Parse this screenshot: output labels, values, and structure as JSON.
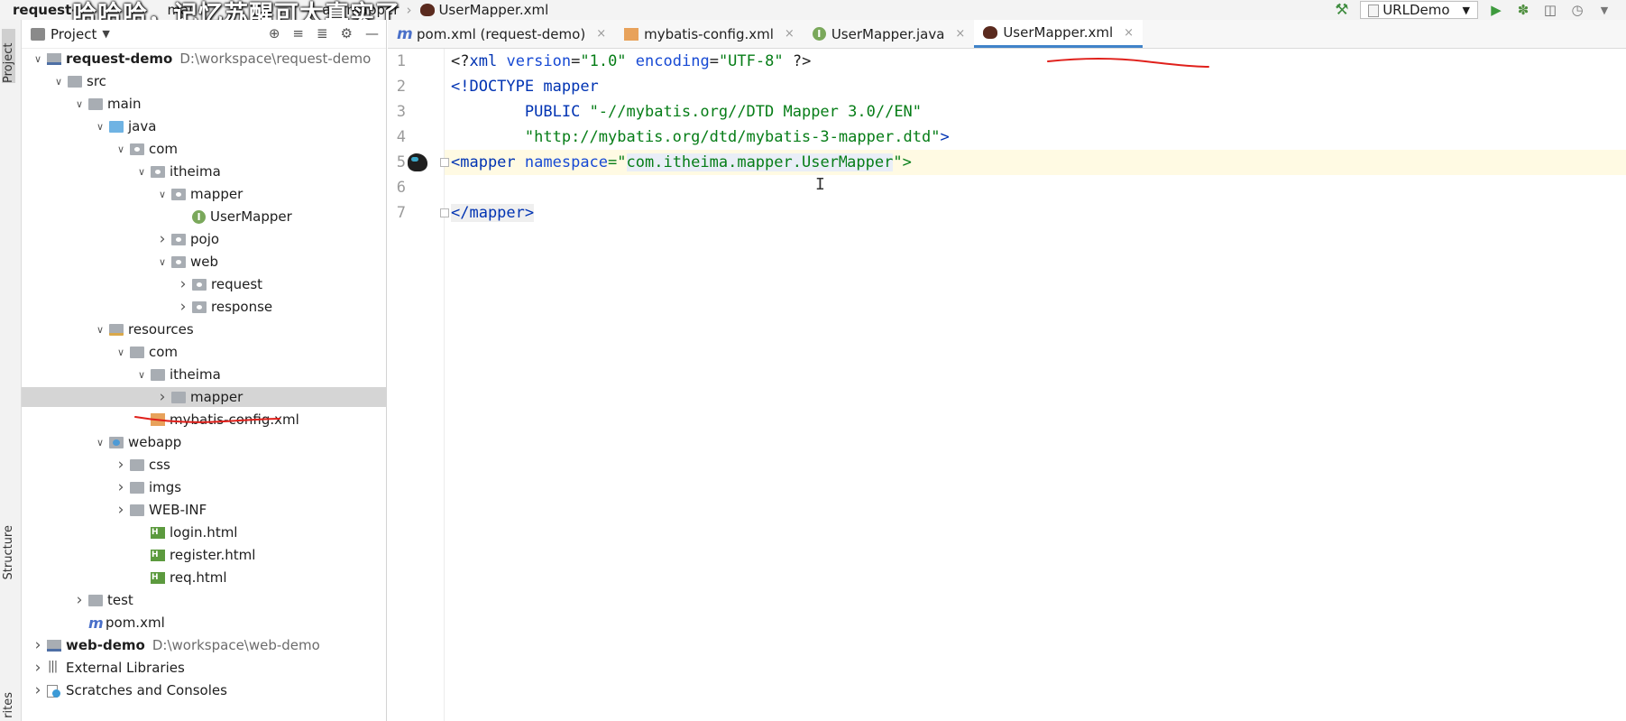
{
  "navbar": {
    "breadcrumbs": [
      "request-",
      "mai",
      "ap",
      "mapper"
    ],
    "current_file": "UserMapper.xml",
    "subtitle": "哈哈哈，记忆苏醒可太真实了"
  },
  "run_config": {
    "name": "URLDemo"
  },
  "side_strip": {
    "project": "Project",
    "structure": "Structure",
    "favorites": "rites"
  },
  "project_panel": {
    "title": "Project",
    "tree": [
      {
        "label": "request-demo",
        "path": "D:\\workspace\\request-demo",
        "icon": "module",
        "indent": 0,
        "arrow": "open",
        "bold": true
      },
      {
        "label": "src",
        "icon": "folder",
        "indent": 1,
        "arrow": "open"
      },
      {
        "label": "main",
        "icon": "folder",
        "indent": 2,
        "arrow": "open"
      },
      {
        "label": "java",
        "icon": "folder-blue",
        "indent": 3,
        "arrow": "open"
      },
      {
        "label": "com",
        "icon": "package",
        "indent": 4,
        "arrow": "open"
      },
      {
        "label": "itheima",
        "icon": "package",
        "indent": 5,
        "arrow": "open"
      },
      {
        "label": "mapper",
        "icon": "package",
        "indent": 6,
        "arrow": "open"
      },
      {
        "label": "UserMapper",
        "icon": "interface",
        "indent": 7,
        "arrow": "none"
      },
      {
        "label": "pojo",
        "icon": "package",
        "indent": 6,
        "arrow": "closed"
      },
      {
        "label": "web",
        "icon": "package",
        "indent": 6,
        "arrow": "open"
      },
      {
        "label": "request",
        "icon": "package",
        "indent": 7,
        "arrow": "closed"
      },
      {
        "label": "response",
        "icon": "package",
        "indent": 7,
        "arrow": "closed"
      },
      {
        "label": "resources",
        "icon": "folder-res",
        "indent": 3,
        "arrow": "open"
      },
      {
        "label": "com",
        "icon": "folder",
        "indent": 4,
        "arrow": "open"
      },
      {
        "label": "itheima",
        "icon": "folder",
        "indent": 5,
        "arrow": "open"
      },
      {
        "label": "mapper",
        "icon": "folder",
        "indent": 6,
        "arrow": "closed",
        "selected": true
      },
      {
        "label": "mybatis-config.xml",
        "icon": "xml",
        "indent": 5,
        "arrow": "none"
      },
      {
        "label": "webapp",
        "icon": "folder-web",
        "indent": 3,
        "arrow": "open"
      },
      {
        "label": "css",
        "icon": "folder",
        "indent": 4,
        "arrow": "closed"
      },
      {
        "label": "imgs",
        "icon": "folder",
        "indent": 4,
        "arrow": "closed"
      },
      {
        "label": "WEB-INF",
        "icon": "folder",
        "indent": 4,
        "arrow": "closed"
      },
      {
        "label": "login.html",
        "icon": "html",
        "indent": 5,
        "arrow": "none"
      },
      {
        "label": "register.html",
        "icon": "html",
        "indent": 5,
        "arrow": "none"
      },
      {
        "label": "req.html",
        "icon": "html",
        "indent": 5,
        "arrow": "none"
      },
      {
        "label": "test",
        "icon": "folder",
        "indent": 2,
        "arrow": "closed"
      },
      {
        "label": "pom.xml",
        "icon": "maven",
        "indent": 2,
        "arrow": "none"
      },
      {
        "label": "web-demo",
        "path": "D:\\workspace\\web-demo",
        "icon": "module",
        "indent": 0,
        "arrow": "closed",
        "bold": true
      },
      {
        "label": "External Libraries",
        "icon": "library",
        "indent": 0,
        "arrow": "closed"
      },
      {
        "label": "Scratches and Consoles",
        "icon": "scratch",
        "indent": 0,
        "arrow": "closed"
      }
    ]
  },
  "tabs": [
    {
      "label": "pom.xml (request-demo)",
      "icon": "maven",
      "active": false
    },
    {
      "label": "mybatis-config.xml",
      "icon": "xml",
      "active": false
    },
    {
      "label": "UserMapper.java",
      "icon": "interface",
      "active": false
    },
    {
      "label": "UserMapper.xml",
      "icon": "mybatis",
      "active": true
    }
  ],
  "editor": {
    "line_numbers": [
      "1",
      "2",
      "3",
      "4",
      "5",
      "6",
      "7"
    ],
    "lines": {
      "l1": {
        "open": "<?",
        "tag": "xml",
        "a1": "version",
        "v1": "\"1.0\"",
        "a2": "encoding",
        "v2": "\"UTF-8\"",
        "close": "?>"
      },
      "l2": {
        "open": "<!DOCTYPE",
        "name": "mapper"
      },
      "l3": {
        "kw": "PUBLIC",
        "val": "\"-//mybatis.org//DTD Mapper 3.0//EN\""
      },
      "l4": {
        "val": "\"http://mybatis.org/dtd/mybatis-3-mapper.dtd\"",
        "close": ">"
      },
      "l5": {
        "open": "<mapper",
        "attr": "namespace",
        "eq": "=\"",
        "val_a": "com.itheima.mapper.UserM",
        "val_b": "apper",
        "close": "\">"
      },
      "l7": {
        "tag": "</mapper>"
      }
    }
  },
  "colors": {
    "accent": "#4083c9",
    "annotation": "#e0201b",
    "string": "#067d17",
    "tag": "#0033b3"
  }
}
